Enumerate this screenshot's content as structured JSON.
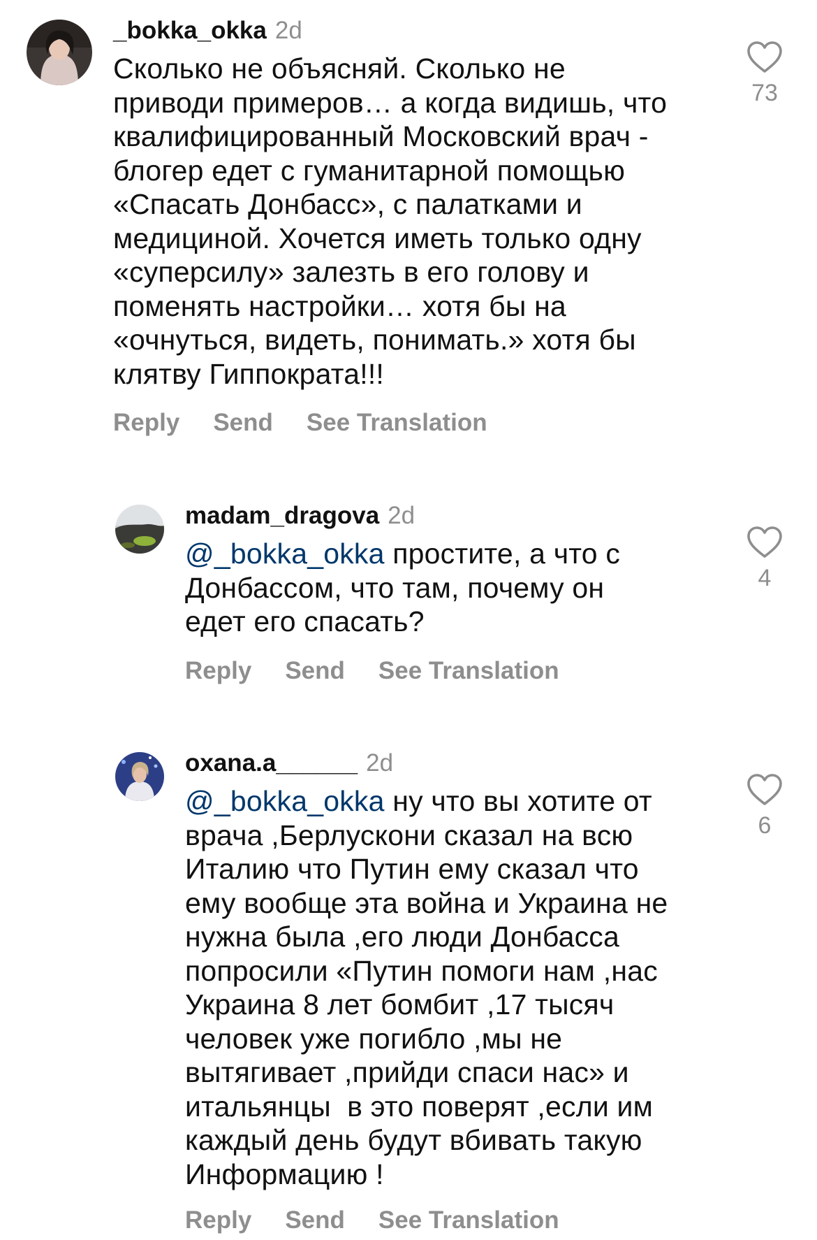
{
  "comments": [
    {
      "username": "_bokka_okka",
      "time": "2d",
      "mention": "",
      "lines": [
        "Сколько не объясняй. Сколько не",
        "приводи примеров… а когда видишь, что",
        "квалифицированный Московский врач -",
        "блогер едет с гуманитарной помощью",
        "«Спасать Донбасс», с палатками и",
        "медициной. Хочется иметь только одну",
        "«суперсилу» залезть в его голову и",
        "поменять настройки… хотя бы на",
        "«очнуться, видеть, понимать.» хотя бы",
        "клятву Гиппократа!!!"
      ],
      "actions": {
        "reply": "Reply",
        "send": "Send",
        "translate": "See Translation"
      },
      "likes": "73"
    },
    {
      "username": "madam_dragova",
      "time": "2d",
      "mention": "@_bokka_okka",
      "lines": [
        " простите, а что с",
        "Донбассом, что там, почему он",
        "едет его спасать?"
      ],
      "actions": {
        "reply": "Reply",
        "send": "Send",
        "translate": "See Translation"
      },
      "likes": "4"
    },
    {
      "username": "oxana.a______",
      "time": "2d",
      "mention": "@_bokka_okka",
      "lines": [
        " ну что вы хотите от",
        "врача ,Берлускони сказал на всю",
        "Италию что Путин ему сказал что",
        "ему вообще эта война и Украина не",
        "нужна была ,его люди Донбасса",
        "попросили «Путин помоги нам ,нас",
        "Украина 8 лет бомбит ,17 тысяч",
        "человек уже погибло ,мы не",
        "вытягивает ,прийди спаси нас» и",
        "итальянцы  в это поверят ,если им",
        "каждый день будут вбивать такую",
        "Информацию !"
      ],
      "actions": {
        "reply": "Reply",
        "send": "Send",
        "translate": "See Translation"
      },
      "likes": "6"
    }
  ]
}
